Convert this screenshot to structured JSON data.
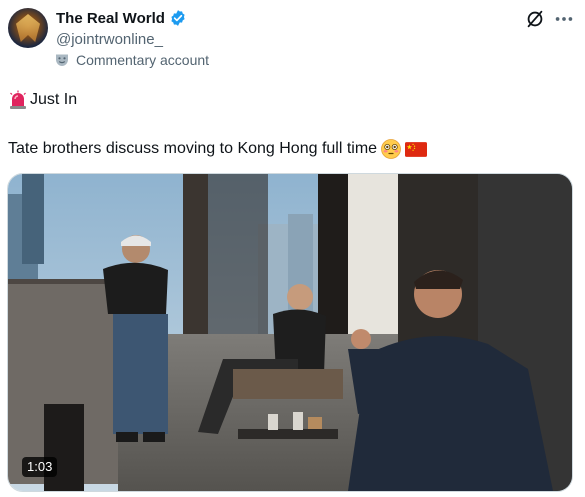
{
  "tweet": {
    "author": {
      "display_name": "The Real World",
      "handle": "@jointrwonline_",
      "verified": true,
      "account_label": "Commentary account"
    },
    "icons": {
      "avatar": "avatar-image",
      "verified": "verified-badge-icon",
      "label": "mask-icon",
      "grok": "grok-icon",
      "more": "more-dots-icon"
    },
    "text": {
      "line1_emoji": "siren-emoji",
      "line1": "Just In",
      "line2": "Tate brothers discuss moving to Kong Hong full time",
      "line2_emojis": [
        "flushed-face-emoji",
        "china-flag-emoji"
      ]
    },
    "media": {
      "type": "video",
      "duration": "1:03"
    },
    "colors": {
      "accent": "#1d9bf0",
      "secondary_text": "#536471",
      "border": "#cfd9de"
    }
  }
}
